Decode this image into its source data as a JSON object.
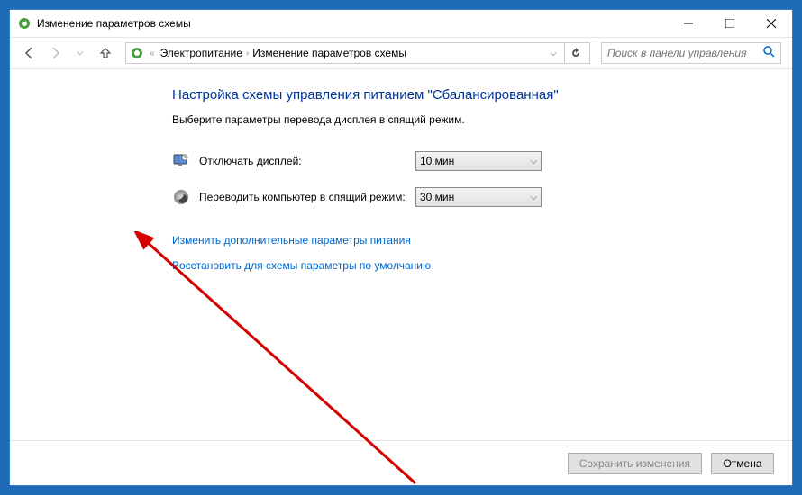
{
  "titlebar": {
    "title": "Изменение параметров схемы"
  },
  "navbar": {
    "breadcrumb": {
      "item1": "Электропитание",
      "item2": "Изменение параметров схемы"
    },
    "search_placeholder": "Поиск в панели управления"
  },
  "content": {
    "heading": "Настройка схемы управления питанием \"Сбалансированная\"",
    "subtext": "Выберите параметры перевода дисплея в спящий режим.",
    "settings": {
      "display_off": {
        "label": "Отключать дисплей:",
        "value": "10 мин"
      },
      "sleep": {
        "label": "Переводить компьютер в спящий режим:",
        "value": "30 мин"
      }
    },
    "links": {
      "advanced": "Изменить дополнительные параметры питания",
      "restore": "Восстановить для схемы параметры по умолчанию"
    }
  },
  "footer": {
    "save": "Сохранить изменения",
    "cancel": "Отмена"
  }
}
